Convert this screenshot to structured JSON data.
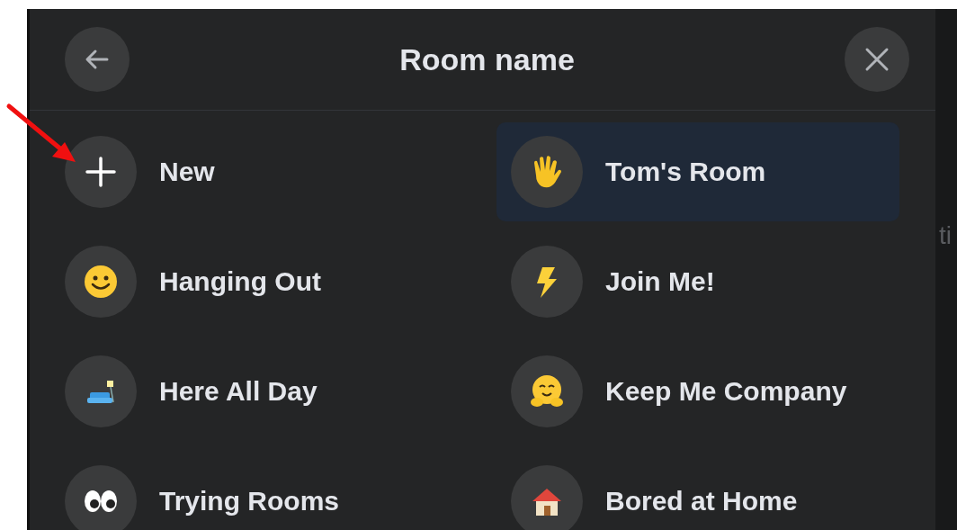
{
  "dialog": {
    "title": "Room name"
  },
  "rooms": [
    {
      "label": "New",
      "kind": "plus",
      "selected": false
    },
    {
      "label": "Tom's Room",
      "kind": "wave",
      "selected": true
    },
    {
      "label": "Hanging Out",
      "kind": "smile",
      "selected": false
    },
    {
      "label": "Join Me!",
      "kind": "bolt",
      "selected": false
    },
    {
      "label": "Here All Day",
      "kind": "sofa",
      "selected": false
    },
    {
      "label": "Keep Me Company",
      "kind": "hug",
      "selected": false
    },
    {
      "label": "Trying Rooms",
      "kind": "eyes",
      "selected": false
    },
    {
      "label": "Bored at Home",
      "kind": "house",
      "selected": false
    }
  ],
  "background_text": "ti"
}
